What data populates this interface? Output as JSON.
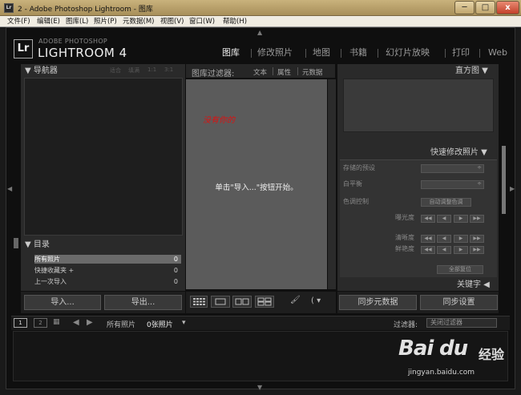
{
  "window": {
    "app_icon": "Lr",
    "title": "2 - Adobe Photoshop Lightroom - 图库",
    "min_icon": "─",
    "max_icon": "□",
    "close_icon": "x"
  },
  "menu": [
    "文件(F)",
    "编辑(E)",
    "图库(L)",
    "照片(P)",
    "元数据(M)",
    "视图(V)",
    "窗口(W)",
    "帮助(H)"
  ],
  "identity": {
    "logo": "Lr",
    "top_line": "ADOBE PHOTOSHOP",
    "product": "LIGHTROOM 4"
  },
  "modules": [
    {
      "label": "图库",
      "active": true
    },
    {
      "label": "修改照片",
      "active": false
    },
    {
      "label": "地图",
      "active": false
    },
    {
      "label": "书籍",
      "active": false
    },
    {
      "label": "幻灯片放映",
      "active": false
    },
    {
      "label": "打印",
      "active": false
    },
    {
      "label": "Web",
      "active": false
    }
  ],
  "left_panel": {
    "navigator": {
      "title": "导航器",
      "zoom_options": [
        "适合",
        "填满",
        "1:1",
        "3:1"
      ]
    },
    "catalog": {
      "title": "目录",
      "rows": [
        {
          "label": "所有照片",
          "count": "0",
          "selected": true
        },
        {
          "label": "快捷收藏夹 +",
          "count": "0",
          "selected": false
        },
        {
          "label": "上一次导入",
          "count": "0",
          "selected": false
        }
      ]
    },
    "import_button": "导入...",
    "export_button": "导出..."
  },
  "center": {
    "filter_label": "图库过滤器:",
    "filter_options": [
      "文本",
      "属性",
      "元数据"
    ],
    "red_note": "没有你的",
    "start_message": "单击\"导入...\"按钮开始。"
  },
  "right_panel": {
    "histogram_title": "直方图",
    "quick_develop_title": "快速修改照片",
    "rows": {
      "saved_preset": "存储的预设",
      "white_balance": "白平衡",
      "tone_control": "色调控制",
      "auto_tone": "自动调整色调",
      "exposure": "曝光度",
      "clarity": "清晰度",
      "vibrance": "鲜艳度",
      "reset": "全部复位"
    },
    "keywords_title": "关键字",
    "sync_metadata": "同步元数据",
    "sync_settings": "同步设置"
  },
  "toolbar": {
    "painter_icon": "🖌"
  },
  "filmstrip": {
    "screen1": "1",
    "screen2": "2",
    "source": "所有照片",
    "count": "0张照片",
    "filter_label": "过滤器:",
    "filter_value": "关闭过滤器"
  },
  "watermark": {
    "brand": "Bai",
    "brand_cn": "经验",
    "url": "jingyan.baidu.com"
  }
}
